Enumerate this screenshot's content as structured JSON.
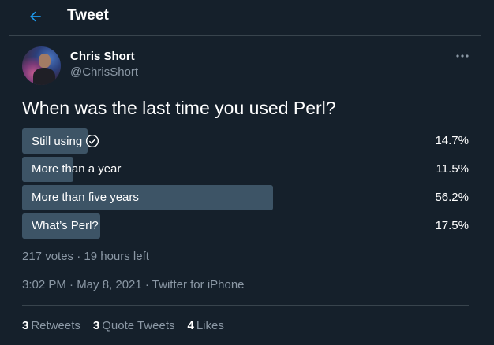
{
  "header": {
    "title": "Tweet"
  },
  "author": {
    "name": "Chris Short",
    "handle": "@ChrisShort"
  },
  "tweet": {
    "text": "When was the last time you used Perl?"
  },
  "poll": {
    "options": [
      {
        "label": "Still using",
        "percent": "14.7%",
        "fraction": 0.147,
        "selected": true
      },
      {
        "label": "More than a year",
        "percent": "11.5%",
        "fraction": 0.115,
        "selected": false
      },
      {
        "label": "More than five years",
        "percent": "56.2%",
        "fraction": 0.562,
        "selected": false
      },
      {
        "label": "What’s Perl?",
        "percent": "17.5%",
        "fraction": 0.175,
        "selected": false
      }
    ],
    "summary": "217 votes · 19 hours left"
  },
  "meta": {
    "timestamp": "3:02 PM · May 8, 2021 · Twitter for iPhone"
  },
  "stats": {
    "retweets_count": "3",
    "retweets_label": "Retweets",
    "quotes_count": "3",
    "quotes_label": "Quote Tweets",
    "likes_count": "4",
    "likes_label": "Likes"
  },
  "colors": {
    "background": "#15202b",
    "accent": "#1d9bf0",
    "poll_bar": "#3d5466",
    "muted_text": "#8b98a5"
  },
  "icons": {
    "back": "arrow-left-icon",
    "more": "more-horizontal-icon",
    "check": "check-circle-icon"
  }
}
